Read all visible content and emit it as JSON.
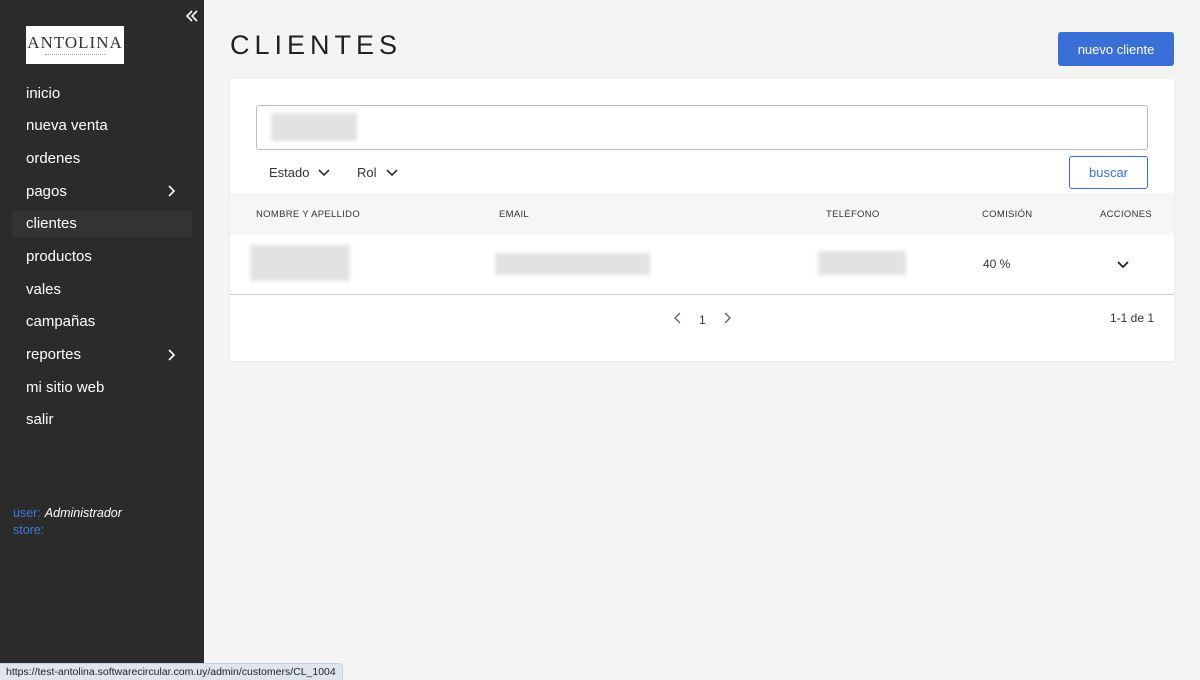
{
  "sidebar": {
    "logo_text": "ANTOLINA",
    "items": [
      {
        "label": "inicio",
        "has_submenu": false
      },
      {
        "label": "nueva venta",
        "has_submenu": false
      },
      {
        "label": "ordenes",
        "has_submenu": false
      },
      {
        "label": "pagos",
        "has_submenu": true
      },
      {
        "label": "clientes",
        "has_submenu": false,
        "active": true
      },
      {
        "label": "productos",
        "has_submenu": false
      },
      {
        "label": "vales",
        "has_submenu": false
      },
      {
        "label": "campañas",
        "has_submenu": false
      },
      {
        "label": "reportes",
        "has_submenu": true
      },
      {
        "label": "mi sitio web",
        "has_submenu": false
      },
      {
        "label": "salir",
        "has_submenu": false
      }
    ],
    "user_label": "user:",
    "user_value": "Administrador",
    "store_label": "store:",
    "store_value": ""
  },
  "header": {
    "title": "CLIENTES",
    "new_button": "nuevo cliente"
  },
  "filters": {
    "estado": "Estado",
    "rol": "Rol",
    "search_button": "buscar"
  },
  "table": {
    "headers": {
      "name": "NOMBRE Y APELLIDO",
      "email": "EMAIL",
      "phone": "TELÉFONO",
      "commission": "COMISIÓN",
      "actions": "ACCIONES"
    },
    "rows": [
      {
        "commission": "40 %"
      }
    ]
  },
  "pagination": {
    "page": "1",
    "summary": "1-1 de 1"
  },
  "status_bar": {
    "url": "https://test-antolina.softwarecircular.com.uy/admin/customers/CL_1004"
  },
  "colors": {
    "sidebar_bg": "#2b2b2b",
    "accent": "#3b6fd8",
    "page_bg": "#f4f4f5"
  }
}
